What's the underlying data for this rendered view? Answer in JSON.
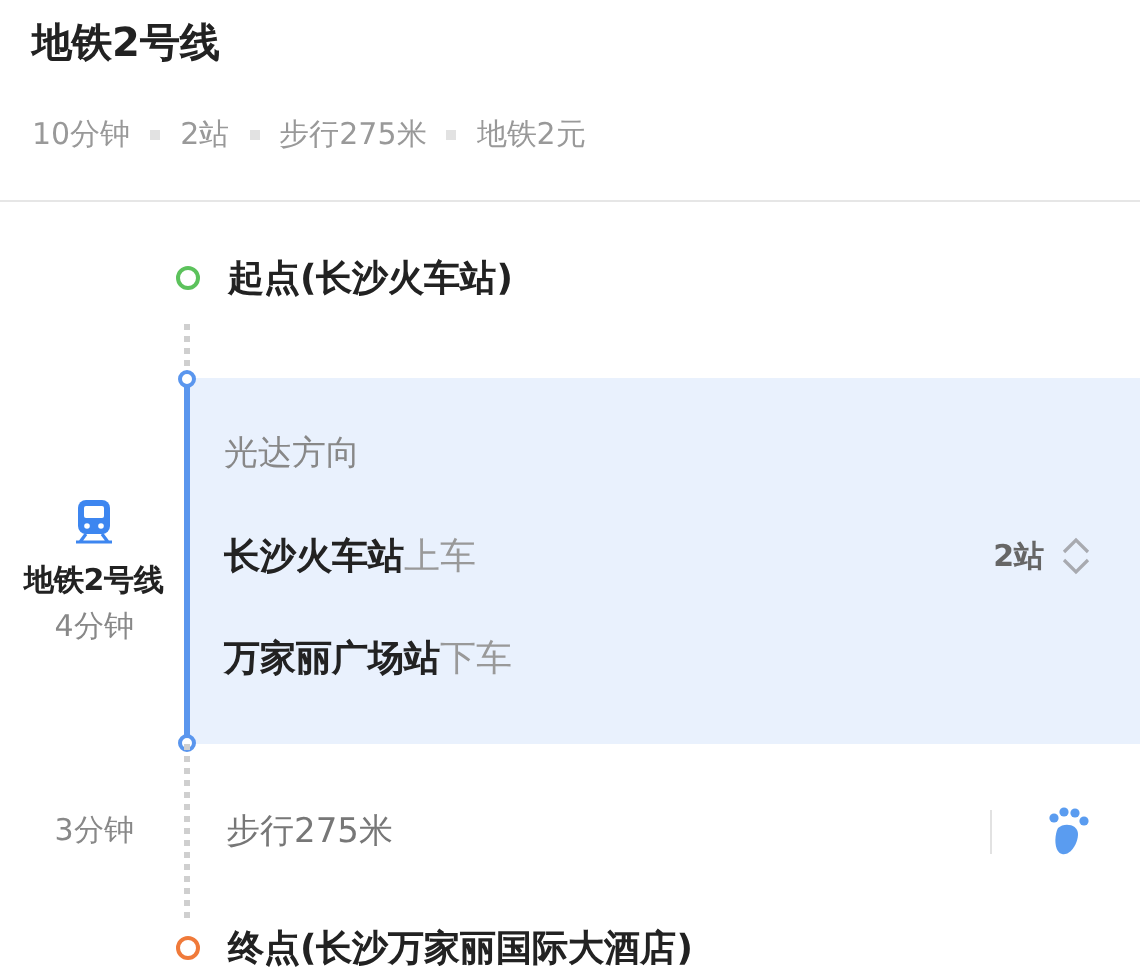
{
  "header": {
    "title": "地铁2号线",
    "summary": [
      "10分钟",
      "2站",
      "步行275米",
      "地铁2元"
    ]
  },
  "route": [
    {
      "kind": "start",
      "label": "起点(长沙火车站)"
    },
    {
      "kind": "subway",
      "line": "地铁2号线",
      "duration": "4分钟",
      "direction": "光达方向",
      "board_station": "长沙火车站",
      "board_action": "上车",
      "alight_station": "万家丽广场站",
      "alight_action": "下车",
      "stops": "2站"
    },
    {
      "kind": "walk",
      "duration": "3分钟",
      "text": "步行275米"
    },
    {
      "kind": "end",
      "label": "终点(长沙万家丽国际大酒店)"
    }
  ]
}
